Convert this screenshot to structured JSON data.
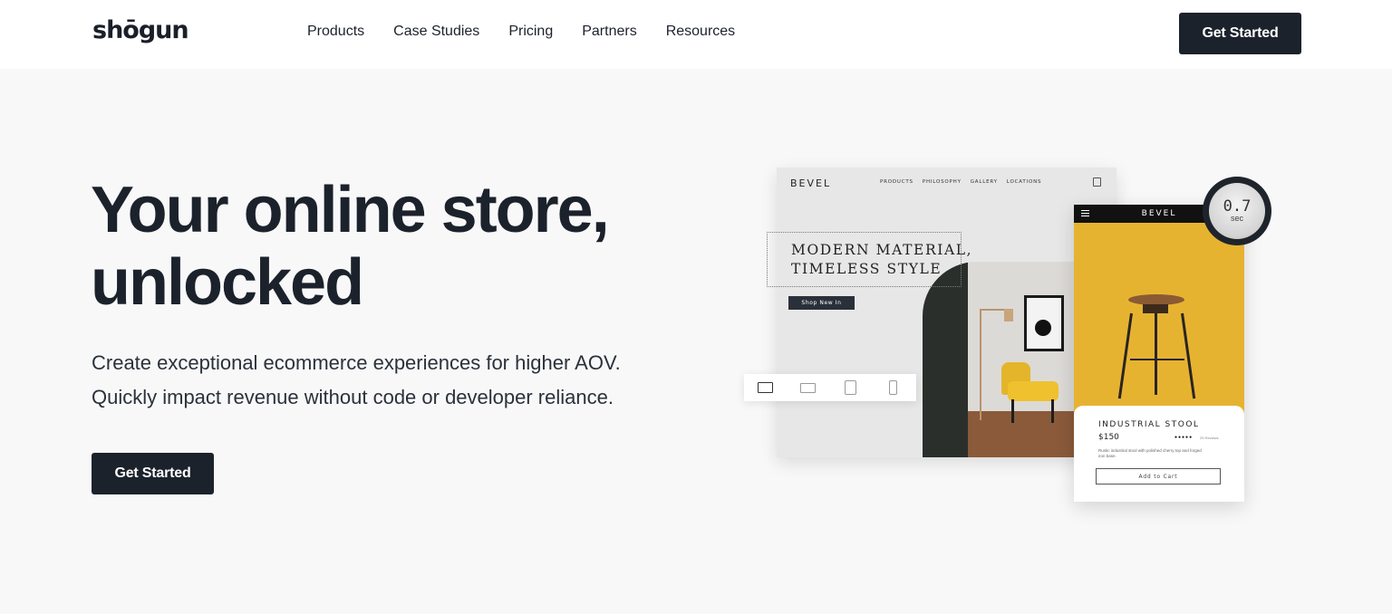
{
  "brand": {
    "logo_text": "shōgun"
  },
  "nav": {
    "links": [
      "Products",
      "Case Studies",
      "Pricing",
      "Partners",
      "Resources"
    ],
    "cta_label": "Get Started"
  },
  "hero": {
    "title_line1": "Your online store,",
    "title_line2": "unlocked",
    "subtitle_line1": "Create exceptional ecommerce experiences for higher AOV.",
    "subtitle_line2": "Quickly impact revenue without code or developer reliance.",
    "cta_label": "Get Started"
  },
  "mockup": {
    "desktop": {
      "brand": "BEVEL",
      "menu": [
        "PRODUCTS",
        "PHILOSOPHY",
        "GALLERY",
        "LOCATIONS"
      ],
      "tagline": "MODERN MATERIAL,\nTIMELESS STYLE",
      "shop_button": "Shop New In"
    },
    "mobile": {
      "brand": "BEVEL",
      "product_name": "INDUSTRIAL STOOL",
      "price": "$150",
      "stars": "●●●●●",
      "reviews": "25 Reviews",
      "description": "Rustic industrial stool with polished cherry top and forged iron base.",
      "add_to_cart": "Add to Cart"
    },
    "load_time": {
      "value": "0.7",
      "unit": "sec"
    },
    "devices": [
      "desktop-icon",
      "laptop-icon",
      "tablet-icon",
      "phone-icon"
    ]
  },
  "colors": {
    "primary_dark": "#1c222c",
    "page_bg": "#f8f8f8",
    "accent_yellow": "#e6b331"
  }
}
